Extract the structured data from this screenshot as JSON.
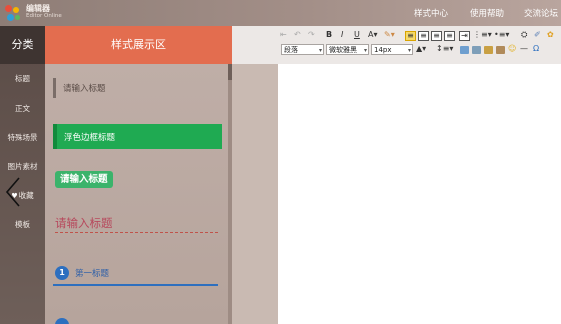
{
  "brand": {
    "name": "编辑器",
    "sub": "Editor Online"
  },
  "nav": [
    {
      "label": "样式中心"
    },
    {
      "label": "使用帮助"
    },
    {
      "label": "交流论坛"
    }
  ],
  "sidebar": {
    "title": "分类",
    "items": [
      {
        "label": "标题"
      },
      {
        "label": "正文"
      },
      {
        "label": "特殊场景"
      },
      {
        "label": "图片素材"
      },
      {
        "label": "收藏"
      },
      {
        "label": "模板"
      }
    ]
  },
  "panel": {
    "title": "样式展示区",
    "styles": [
      {
        "text": "请输入标题"
      },
      {
        "text": "浮色边框标题"
      },
      {
        "text": "请输入标题"
      },
      {
        "text": "请输入标题"
      },
      {
        "number": "1",
        "text": "第一标题"
      }
    ]
  },
  "toolbar": {
    "bold": "B",
    "italic": "I",
    "underline": "U",
    "font_color": "A",
    "paragraph": "段落",
    "font_family": "微软雅黑",
    "font_size": "14px"
  },
  "colors": {
    "accent": "#e36d4f",
    "green": "#1faa52",
    "blue": "#2d6fbf"
  }
}
